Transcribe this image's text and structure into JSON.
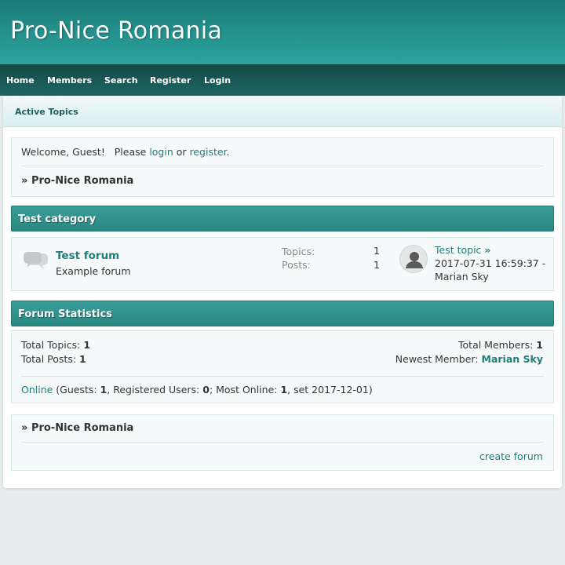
{
  "site": {
    "title": "Pro-Nice Romania"
  },
  "nav": {
    "items": [
      {
        "label": "Home"
      },
      {
        "label": "Members"
      },
      {
        "label": "Search"
      },
      {
        "label": "Register"
      },
      {
        "label": "Login"
      }
    ]
  },
  "subnav": {
    "active_topics": "Active Topics"
  },
  "welcome": {
    "prefix": "Welcome, Guest!   Please ",
    "login": "login",
    "or": " or ",
    "register": "register",
    "suffix": ".",
    "breadcrumb_sep": "»",
    "breadcrumb": "Pro-Nice Romania"
  },
  "category": {
    "title": "Test category",
    "forum": {
      "name": "Test forum",
      "description": "Example forum",
      "topics_label": "Topics:",
      "topics_value": "1",
      "posts_label": "Posts:",
      "posts_value": "1",
      "last_post_title": "Test topic",
      "last_post_arrow": "»",
      "last_post_date": "2017-07-31 16:59:37 -",
      "last_post_author": "Marian Sky"
    }
  },
  "stats": {
    "title": "Forum Statistics",
    "total_topics_label": "Total Topics: ",
    "total_topics": "1",
    "total_posts_label": "Total Posts: ",
    "total_posts": "1",
    "total_members_label": "Total Members: ",
    "total_members": "1",
    "newest_member_label": "Newest Member: ",
    "newest_member": "Marian Sky",
    "online_link": "Online",
    "online_a": " (Guests: ",
    "guests": "1",
    "online_b": ", Registered Users: ",
    "registered": "0",
    "online_c": "; Most Online: ",
    "most_online": "1",
    "online_d": ", set 2017-12-01)"
  },
  "footer": {
    "breadcrumb_sep": "»",
    "breadcrumb": "Pro-Nice Romania",
    "create_forum": "create forum"
  },
  "colors": {
    "header": "#24918c",
    "nav": "#1a5c5a",
    "link": "#1f7e79",
    "category_bar": "#2f918c",
    "page_bg": "#e5eeec"
  },
  "icons": {
    "forum": "speech-bubbles-icon",
    "avatar": "user-silhouette-icon"
  }
}
